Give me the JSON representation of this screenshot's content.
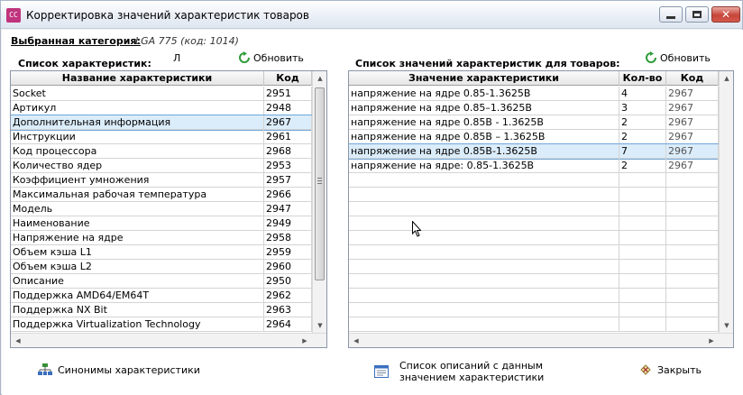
{
  "window": {
    "title": "Корректировка значений характеристик товаров",
    "app_icon": "CC"
  },
  "category": {
    "label": "Выбранная категория:",
    "value": "LGA 775 (код: 1014)"
  },
  "stray_text": "Л",
  "left_panel": {
    "title": "Список характеристик:",
    "refresh_label": "Обновить",
    "columns": [
      "Название характеристики",
      "Код"
    ],
    "rows": [
      {
        "name": "Socket",
        "code": "2951"
      },
      {
        "name": "Артикул",
        "code": "2948"
      },
      {
        "name": "Дополнительная информация",
        "code": "2967"
      },
      {
        "name": "Инструкции",
        "code": "2961"
      },
      {
        "name": "Код процессора",
        "code": "2968"
      },
      {
        "name": "Количество ядер",
        "code": "2953"
      },
      {
        "name": "Коэффициент умножения",
        "code": "2957"
      },
      {
        "name": "Максимальная рабочая температура",
        "code": "2966"
      },
      {
        "name": "Модель",
        "code": "2947"
      },
      {
        "name": "Наименование",
        "code": "2949"
      },
      {
        "name": "Напряжение на ядре",
        "code": "2958"
      },
      {
        "name": "Объем кэша L1",
        "code": "2959"
      },
      {
        "name": "Объем кэша L2",
        "code": "2960"
      },
      {
        "name": "Описание",
        "code": "2950"
      },
      {
        "name": "Поддержка AMD64/EM64T",
        "code": "2962"
      },
      {
        "name": "Поддержка NX Bit",
        "code": "2963"
      },
      {
        "name": "Поддержка Virtualization Technology",
        "code": "2964"
      }
    ],
    "selected_index": 2
  },
  "right_panel": {
    "title": "Список значений характеристик для товаров:",
    "refresh_label": "Обновить",
    "columns": [
      "Значение характеристики",
      "Кол-во",
      "Код"
    ],
    "rows": [
      {
        "value": "напряжение на ядре 0.85-1.3625В",
        "count": "4",
        "code": "2967"
      },
      {
        "value": "напряжение на ядре 0.85–1.3625В",
        "count": "3",
        "code": "2967"
      },
      {
        "value": "напряжение на ядре 0.85В - 1.3625В",
        "count": "2",
        "code": "2967"
      },
      {
        "value": "напряжение на ядре 0.85В – 1.3625В",
        "count": "2",
        "code": "2967"
      },
      {
        "value": "напряжение на ядре 0.85В-1.3625В",
        "count": "7",
        "code": "2967"
      },
      {
        "value": "напряжение на ядре: 0.85-1.3625В",
        "count": "2",
        "code": "2967"
      }
    ],
    "selected_index": 4
  },
  "bottom": {
    "synonyms_label": "Синонимы характеристики",
    "descriptions_label_line1": "Список описаний с данным",
    "descriptions_label_line2": "значением характеристики",
    "close_label": "Закрыть"
  }
}
